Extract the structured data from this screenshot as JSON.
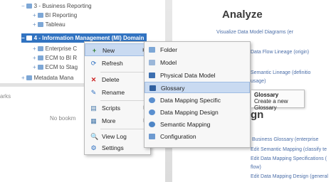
{
  "tree": {
    "items": [
      {
        "label": "3 - Business Reporting",
        "expander": "−"
      },
      {
        "label": "BI Reporting",
        "expander": "+"
      },
      {
        "label": "Tableau",
        "expander": "+"
      },
      {
        "label": "4 - Information Management (MI) Domain",
        "expander": "−",
        "selected": true
      },
      {
        "label": "Enterprise C",
        "expander": "+"
      },
      {
        "label": "ECM to BI R",
        "expander": "+"
      },
      {
        "label": "ECM to Stag",
        "expander": "+"
      },
      {
        "label": "Metadata Mana",
        "expander": "+"
      }
    ],
    "bottom_left_label": "arks",
    "no_bookmarks_label": "No bookm"
  },
  "context_menu": {
    "items": [
      {
        "label": "New",
        "icon": "plus-icon",
        "has_submenu": true
      },
      {
        "label": "Refresh",
        "icon": "refresh-icon",
        "has_submenu": false
      },
      {
        "label": "Delete",
        "icon": "delete-icon",
        "has_submenu": false
      },
      {
        "label": "Rename",
        "icon": "rename-icon",
        "has_submenu": false
      },
      {
        "label": "Scripts",
        "icon": "scripts-icon",
        "has_submenu": true
      },
      {
        "label": "More",
        "icon": "more-icon",
        "has_submenu": true
      },
      {
        "label": "View Log",
        "icon": "log-icon",
        "has_submenu": false
      },
      {
        "label": "Settings",
        "icon": "settings-icon",
        "has_submenu": false
      }
    ]
  },
  "sub_menu": {
    "items": [
      {
        "label": "Folder",
        "icon": "folder-icon"
      },
      {
        "label": "Model",
        "icon": "model-icon"
      },
      {
        "label": "Physical Data Model",
        "icon": "physical-model-icon"
      },
      {
        "label": "Glossary",
        "icon": "glossary-icon",
        "active": true
      },
      {
        "label": "Data Mapping Specific",
        "icon": "data-mapping-spec-icon"
      },
      {
        "label": "Data Mapping Design",
        "icon": "data-mapping-design-icon"
      },
      {
        "label": "Semantic Mapping",
        "icon": "semantic-mapping-icon"
      },
      {
        "label": "Configuration",
        "icon": "configuration-icon"
      }
    ]
  },
  "tooltip": {
    "title": "Glossary",
    "description": "Create a new Glossary"
  },
  "right_panel": {
    "analyze_title": "Analyze",
    "design_title": "gn",
    "analyze_lines": [
      "Visualize Data Model Diagrams (er",
      "Data Flow Lineage (origin)",
      "Semantic Lineage (definitio",
      "usage)"
    ],
    "design_lines": [
      "Business Glossary (enterprise",
      "Edit Semantic Mapping (classify te",
      "Edit Data Mapping Specifications (",
      "flow)",
      "Edit Data Mapping Design (general"
    ]
  },
  "colors": {
    "selection": "#3173c1",
    "menu_highlight": "#c9daf1",
    "link_text": "#4b6ea8"
  }
}
